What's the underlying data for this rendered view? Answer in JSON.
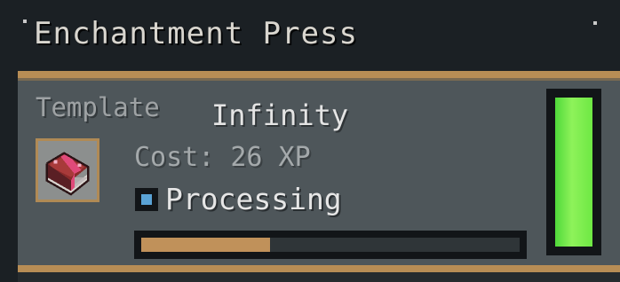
{
  "window": {
    "title": "Enchantment Press"
  },
  "template": {
    "label": "Template",
    "enchantment": "Infinity",
    "cost": "Cost: 26 XP",
    "slot_item": "enchanted-book-icon"
  },
  "status": {
    "label": "Processing",
    "indicator_color": "#5aa3d6"
  },
  "progress": {
    "fraction": 0.34,
    "fill_color": "#c0915a"
  },
  "energy": {
    "fraction": 1.0,
    "fill_color": "#6ee844"
  },
  "colors": {
    "accent": "#b88d55",
    "panel": "#4e565a",
    "background": "#1b2024"
  }
}
